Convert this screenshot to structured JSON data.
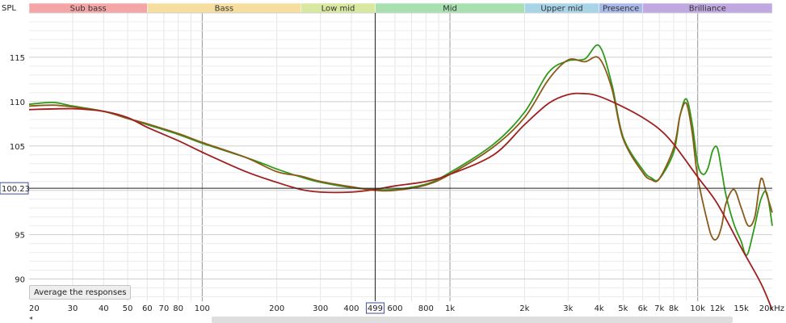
{
  "chart_data": {
    "type": "line",
    "y_axis_title": "SPL",
    "x_scale": "log",
    "xlim": [
      20,
      20000
    ],
    "ylim": [
      87.5,
      120
    ],
    "grid": true,
    "bands": [
      {
        "name": "Sub bass",
        "from": 20,
        "to": 60,
        "color": "#f4a6a6"
      },
      {
        "name": "Bass",
        "from": 60,
        "to": 250,
        "color": "#f5dea0"
      },
      {
        "name": "Low mid",
        "from": 250,
        "to": 500,
        "color": "#d8e8a0"
      },
      {
        "name": "Mid",
        "from": 500,
        "to": 2000,
        "color": "#a8e0b0"
      },
      {
        "name": "Upper mid",
        "from": 2000,
        "to": 4000,
        "color": "#a8d4e8"
      },
      {
        "name": "Presence",
        "from": 4000,
        "to": 6000,
        "color": "#a8b8e8"
      },
      {
        "name": "Brilliance",
        "from": 6000,
        "to": 20000,
        "color": "#c0a8e0"
      }
    ],
    "x_ticks": [
      {
        "value": 20,
        "label": "20"
      },
      {
        "value": 30,
        "label": "30"
      },
      {
        "value": 40,
        "label": "40"
      },
      {
        "value": 50,
        "label": "50"
      },
      {
        "value": 60,
        "label": "60"
      },
      {
        "value": 70,
        "label": "70"
      },
      {
        "value": 80,
        "label": "80"
      },
      {
        "value": 100,
        "label": "100"
      },
      {
        "value": 200,
        "label": "200"
      },
      {
        "value": 300,
        "label": "300"
      },
      {
        "value": 400,
        "label": "400"
      },
      {
        "value": 600,
        "label": "600"
      },
      {
        "value": 800,
        "label": "800"
      },
      {
        "value": 1000,
        "label": "1k"
      },
      {
        "value": 2000,
        "label": "2k"
      },
      {
        "value": 3000,
        "label": "3k"
      },
      {
        "value": 4000,
        "label": "4k"
      },
      {
        "value": 5000,
        "label": "5k"
      },
      {
        "value": 6000,
        "label": "6k"
      },
      {
        "value": 7000,
        "label": "7k"
      },
      {
        "value": 8000,
        "label": "8k"
      },
      {
        "value": 10000,
        "label": "10k"
      },
      {
        "value": 12000,
        "label": "12k"
      },
      {
        "value": 15000,
        "label": "15k"
      },
      {
        "value": 20000,
        "label": "20kHz"
      }
    ],
    "y_ticks": [
      90,
      95,
      105,
      110,
      115
    ],
    "cursor": {
      "x": 499,
      "x_label": "499",
      "y": 100.23,
      "y_label": "100.23"
    },
    "series": [
      {
        "color": "#2f9a1a",
        "points": [
          [
            20,
            109.7
          ],
          [
            25,
            109.9
          ],
          [
            30,
            109.5
          ],
          [
            40,
            108.9
          ],
          [
            50,
            108.1
          ],
          [
            60,
            107.4
          ],
          [
            80,
            106.3
          ],
          [
            100,
            105.3
          ],
          [
            150,
            103.7
          ],
          [
            180,
            102.9
          ],
          [
            200,
            102.4
          ],
          [
            250,
            101.5
          ],
          [
            300,
            100.9
          ],
          [
            400,
            100.3
          ],
          [
            499,
            100.1
          ],
          [
            600,
            100.1
          ],
          [
            800,
            100.7
          ],
          [
            1000,
            102.0
          ],
          [
            1500,
            105.2
          ],
          [
            2000,
            108.8
          ],
          [
            2500,
            113.3
          ],
          [
            3000,
            114.6
          ],
          [
            3500,
            114.8
          ],
          [
            4000,
            116.3
          ],
          [
            4500,
            112.0
          ],
          [
            5000,
            106.0
          ],
          [
            6000,
            102.3
          ],
          [
            6500,
            101.4
          ],
          [
            7000,
            101.3
          ],
          [
            8000,
            104.3
          ],
          [
            8500,
            108.5
          ],
          [
            9000,
            110.3
          ],
          [
            9500,
            107.5
          ],
          [
            10000,
            103.0
          ],
          [
            10500,
            101.8
          ],
          [
            11000,
            102.5
          ],
          [
            11500,
            104.5
          ],
          [
            12000,
            104.8
          ],
          [
            12500,
            102.2
          ],
          [
            13000,
            99.5
          ],
          [
            14000,
            96.2
          ],
          [
            15000,
            94.2
          ],
          [
            15500,
            92.9
          ],
          [
            16000,
            93.0
          ],
          [
            17000,
            96.0
          ],
          [
            18000,
            99.0
          ],
          [
            19000,
            99.7
          ],
          [
            20000,
            96.0
          ]
        ]
      },
      {
        "color": "#8b5a1a",
        "points": [
          [
            20,
            109.5
          ],
          [
            25,
            109.6
          ],
          [
            30,
            109.4
          ],
          [
            40,
            108.9
          ],
          [
            50,
            108.1
          ],
          [
            60,
            107.5
          ],
          [
            80,
            106.4
          ],
          [
            100,
            105.4
          ],
          [
            150,
            103.7
          ],
          [
            200,
            102.1
          ],
          [
            250,
            101.6
          ],
          [
            300,
            101.0
          ],
          [
            400,
            100.4
          ],
          [
            499,
            100.0
          ],
          [
            600,
            100.0
          ],
          [
            800,
            100.6
          ],
          [
            1000,
            101.8
          ],
          [
            1500,
            104.9
          ],
          [
            2000,
            108.2
          ],
          [
            2500,
            112.5
          ],
          [
            3000,
            114.7
          ],
          [
            3500,
            114.5
          ],
          [
            4000,
            114.9
          ],
          [
            4500,
            111.5
          ],
          [
            5000,
            105.8
          ],
          [
            6000,
            102.0
          ],
          [
            6500,
            101.2
          ],
          [
            7000,
            101.3
          ],
          [
            8000,
            104.8
          ],
          [
            8500,
            108.5
          ],
          [
            9000,
            109.8
          ],
          [
            9500,
            106.5
          ],
          [
            10000,
            101.5
          ],
          [
            11000,
            96.2
          ],
          [
            11500,
            94.6
          ],
          [
            12000,
            94.6
          ],
          [
            12500,
            96.0
          ],
          [
            13000,
            98.5
          ],
          [
            14000,
            100.1
          ],
          [
            15000,
            98.0
          ],
          [
            16000,
            96.0
          ],
          [
            17000,
            97.0
          ],
          [
            18000,
            101.3
          ],
          [
            19000,
            99.5
          ],
          [
            20000,
            97.5
          ]
        ]
      },
      {
        "color": "#a01f1f",
        "points": [
          [
            20,
            109.1
          ],
          [
            30,
            109.2
          ],
          [
            40,
            108.9
          ],
          [
            50,
            108.2
          ],
          [
            60,
            107.1
          ],
          [
            80,
            105.6
          ],
          [
            100,
            104.3
          ],
          [
            150,
            102.1
          ],
          [
            200,
            100.9
          ],
          [
            250,
            100.1
          ],
          [
            300,
            99.8
          ],
          [
            400,
            99.8
          ],
          [
            499,
            100.1
          ],
          [
            600,
            100.5
          ],
          [
            800,
            101.0
          ],
          [
            1000,
            101.8
          ],
          [
            1500,
            104.0
          ],
          [
            2000,
            107.4
          ],
          [
            2500,
            109.8
          ],
          [
            3000,
            110.8
          ],
          [
            3500,
            110.9
          ],
          [
            4000,
            110.6
          ],
          [
            5000,
            109.4
          ],
          [
            6000,
            108.2
          ],
          [
            7000,
            106.9
          ],
          [
            8000,
            105.2
          ],
          [
            10000,
            101.5
          ],
          [
            12000,
            98.5
          ],
          [
            15000,
            93.5
          ],
          [
            18000,
            89.5
          ],
          [
            20000,
            86.5
          ]
        ]
      }
    ]
  },
  "ui": {
    "average_button": "Average the responses",
    "scroll_left": "◂"
  }
}
